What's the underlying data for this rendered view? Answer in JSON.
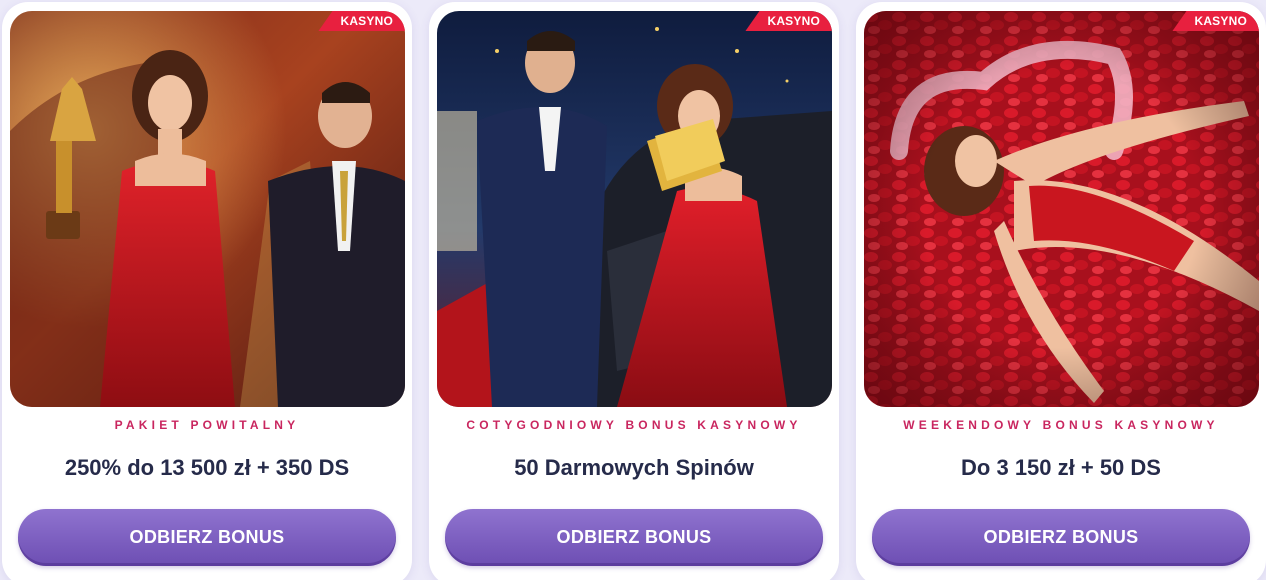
{
  "colors": {
    "page_background": "#eceaf9",
    "badge": "#e8203f",
    "category_text": "#c9265f",
    "title_text": "#262b4a",
    "button": "#7b5cc0"
  },
  "cards": [
    {
      "badge": "KASYNO",
      "category": "PAKIET POWITALNY",
      "title": "250% do 13 500 zł + 350 DS",
      "button_label": "ODBIERZ BONUS"
    },
    {
      "badge": "KASYNO",
      "category": "COTYGODNIOWY BONUS KASYNOWY",
      "title": "50 Darmowych Spinów",
      "button_label": "ODBIERZ BONUS"
    },
    {
      "badge": "KASYNO",
      "category": "WEEKENDOWY BONUS KASYNOWY",
      "title": "Do 3 150 zł + 50 DS",
      "button_label": "ODBIERZ BONUS"
    }
  ]
}
